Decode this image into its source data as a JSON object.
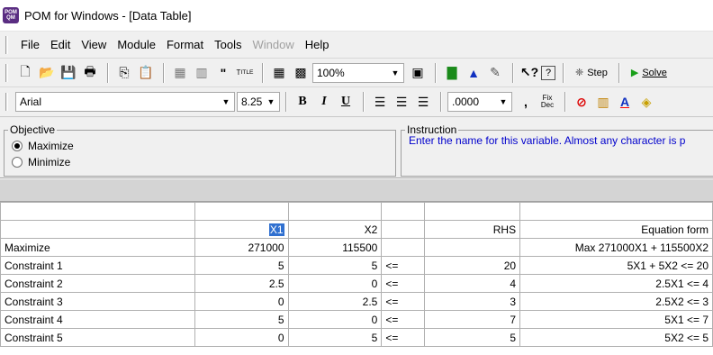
{
  "window": {
    "title": "POM for Windows - [Data Table]",
    "icon_text": "POM QM"
  },
  "menu": [
    "File",
    "Edit",
    "View",
    "Module",
    "Format",
    "Tools",
    "Window",
    "Help"
  ],
  "toolbar": {
    "zoom": "100%",
    "step_label": "Step",
    "solve_label": "Solve"
  },
  "format_bar": {
    "font": "Arial",
    "size": "8.25",
    "decimals": ".0000",
    "fix_dec": "Fix\nDec"
  },
  "objective": {
    "label": "Objective",
    "options": [
      "Maximize",
      "Minimize"
    ],
    "selected": "Maximize"
  },
  "instruction": {
    "label": "Instruction",
    "text": "Enter the name for this variable. Almost any character is p"
  },
  "table": {
    "header": [
      "",
      "X1",
      "X2",
      "",
      "RHS",
      "Equation form"
    ],
    "rows": [
      [
        "Maximize",
        "271000",
        "115500",
        "",
        "",
        "Max 271000X1 + 115500X2"
      ],
      [
        "Constraint 1",
        "5",
        "5",
        "<=",
        "20",
        "5X1 + 5X2 <= 20"
      ],
      [
        "Constraint 2",
        "2.5",
        "0",
        "<=",
        "4",
        "2.5X1 <= 4"
      ],
      [
        "Constraint 3",
        "0",
        "2.5",
        "<=",
        "3",
        "2.5X2 <= 3"
      ],
      [
        "Constraint 4",
        "5",
        "0",
        "<=",
        "7",
        "5X1 <= 7"
      ],
      [
        "Constraint 5",
        "0",
        "5",
        "<=",
        "5",
        "5X2 <= 5"
      ]
    ]
  }
}
